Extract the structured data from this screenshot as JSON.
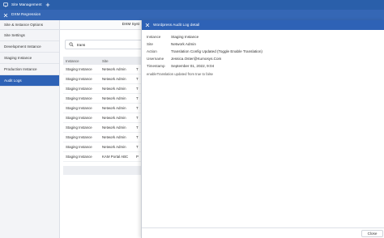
{
  "app": {
    "title": "Site Management",
    "add_icon": "plus-icon",
    "monitor_icon": "monitor-icon"
  },
  "subheader": {
    "title": "DXM Regression",
    "close_icon": "close-icon"
  },
  "sidebar": {
    "header": "Site & Instance Options",
    "items": [
      {
        "label": "Site Settings",
        "active": false
      },
      {
        "label": "Development Instance",
        "active": false
      },
      {
        "label": "Staging Instance",
        "active": false
      },
      {
        "label": "Production Instance",
        "active": false
      },
      {
        "label": "Audit Logs",
        "active": true
      }
    ]
  },
  "main": {
    "header": "DXM Syst",
    "search": {
      "value": "trans",
      "icon": "search-icon"
    },
    "columns": [
      "Instance",
      "Site",
      ""
    ],
    "rows": [
      {
        "instance": "Staging Instance",
        "site": "Network Admin",
        "c3": "T"
      },
      {
        "instance": "Staging Instance",
        "site": "Network Admin",
        "c3": "T"
      },
      {
        "instance": "Staging Instance",
        "site": "Network Admin",
        "c3": "T"
      },
      {
        "instance": "Staging Instance",
        "site": "Network Admin",
        "c3": "T"
      },
      {
        "instance": "Staging Instance",
        "site": "Network Admin",
        "c3": "T"
      },
      {
        "instance": "Staging Instance",
        "site": "Network Admin",
        "c3": "T"
      },
      {
        "instance": "Staging Instance",
        "site": "Network Admin",
        "c3": "T"
      },
      {
        "instance": "Staging Instance",
        "site": "Network Admin",
        "c3": "T"
      },
      {
        "instance": "Staging Instance",
        "site": "Network Admin",
        "c3": "T"
      },
      {
        "instance": "Staging Instance",
        "site": "KAM Portal ABC",
        "c3": "P"
      }
    ]
  },
  "drawer": {
    "title": "Wordpress Audit Log detail",
    "close_icon": "close-icon",
    "fields": [
      {
        "label": "Instance",
        "value": "Staging Instance"
      },
      {
        "label": "Site",
        "value": "Network Admin"
      },
      {
        "label": "Action",
        "value": "Translation Config Updated (Toggle Enable Translation)"
      },
      {
        "label": "Username",
        "value": "Jessica.Oster@Kumosys.Com"
      },
      {
        "label": "Timestamp",
        "value": "September 01, 2022, 9:04"
      }
    ],
    "note": "enableTranslation updated from true to false",
    "close_label": "Close"
  },
  "colors": {
    "primary": "#2e62b6",
    "topbar": "#2a5faa",
    "sidebar_bg": "#f3f4f7"
  }
}
